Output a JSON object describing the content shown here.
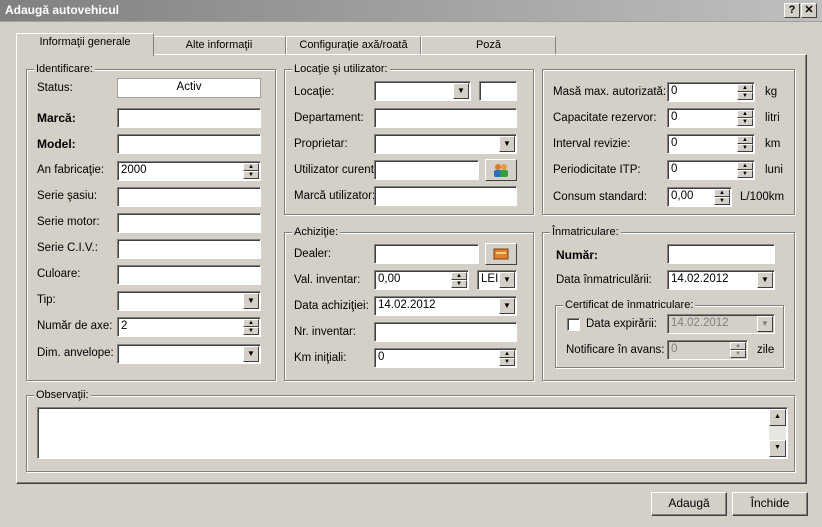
{
  "window": {
    "title": "Adaugă autovehicul",
    "help_label": "?",
    "close_label": "✕"
  },
  "tabs": [
    {
      "label": "Informaţii generale"
    },
    {
      "label": "Alte informaţii"
    },
    {
      "label": "Configuraţie axă/roată"
    },
    {
      "label": "Poză"
    }
  ],
  "identificare": {
    "legend": "Identificare:",
    "status_label": "Status:",
    "status_value": "Activ",
    "marca_label": "Marcă:",
    "marca_value": "",
    "model_label": "Model:",
    "model_value": "",
    "an_label": "An fabricaţie:",
    "an_value": "2000",
    "serie_sasiu_label": "Serie şasiu:",
    "serie_sasiu_value": "",
    "serie_motor_label": "Serie motor:",
    "serie_motor_value": "",
    "serie_civ_label": "Serie C.I.V.:",
    "serie_civ_value": "",
    "culoare_label": "Culoare:",
    "culoare_value": "",
    "tip_label": "Tip:",
    "tip_value": "",
    "numar_axe_label": "Număr de axe:",
    "numar_axe_value": "2",
    "dim_anvelope_label": "Dim. anvelope:",
    "dim_anvelope_value": ""
  },
  "locatie": {
    "legend": "Locaţie şi utilizator:",
    "locatie_label": "Locaţie:",
    "locatie_value": "",
    "locatie_extra": "",
    "departament_label": "Departament:",
    "departament_value": "",
    "proprietar_label": "Proprietar:",
    "proprietar_value": "",
    "utilizator_label": "Utilizator curent:",
    "utilizator_value": "",
    "marca_utilizator_label": "Marcă utilizator:",
    "marca_utilizator_value": ""
  },
  "achizitie": {
    "legend": "Achiziţie:",
    "dealer_label": "Dealer:",
    "dealer_value": "",
    "val_inventar_label": "Val. inventar:",
    "val_inventar_value": "0,00",
    "currency_value": "LEI",
    "data_achizitiei_label": "Data achiziţiei:",
    "data_achizitiei_value": "14.02.2012",
    "nr_inventar_label": "Nr. inventar:",
    "nr_inventar_value": "",
    "km_initiali_label": "Km iniţiali:",
    "km_initiali_value": "0"
  },
  "specs": {
    "masa_label": "Masă max. autorizată:",
    "masa_value": "0",
    "masa_unit": "kg",
    "capacitate_label": "Capacitate rezervor:",
    "capacitate_value": "0",
    "capacitate_unit": "litri",
    "interval_label": "Interval revizie:",
    "interval_value": "0",
    "interval_unit": "km",
    "itp_label": "Periodicitate ITP:",
    "itp_value": "0",
    "itp_unit": "luni",
    "consum_label": "Consum standard:",
    "consum_value": "0,00",
    "consum_unit": "L/100km"
  },
  "inmatriculare": {
    "legend": "Înmatriculare:",
    "numar_label": "Număr:",
    "numar_value": "",
    "data_label": "Data înmatriculării:",
    "data_value": "14.02.2012",
    "certificat_legend": "Certificat de înmatriculare:",
    "data_expirarii_label": "Data expirării:",
    "data_expirarii_value": "14.02.2012",
    "notificare_label": "Notificare în avans:",
    "notificare_value": "0",
    "notificare_unit": "zile"
  },
  "observatii": {
    "legend": "Observaţii:",
    "value": ""
  },
  "buttons": {
    "add_label": "Adaugă",
    "close_label": "Închide"
  }
}
